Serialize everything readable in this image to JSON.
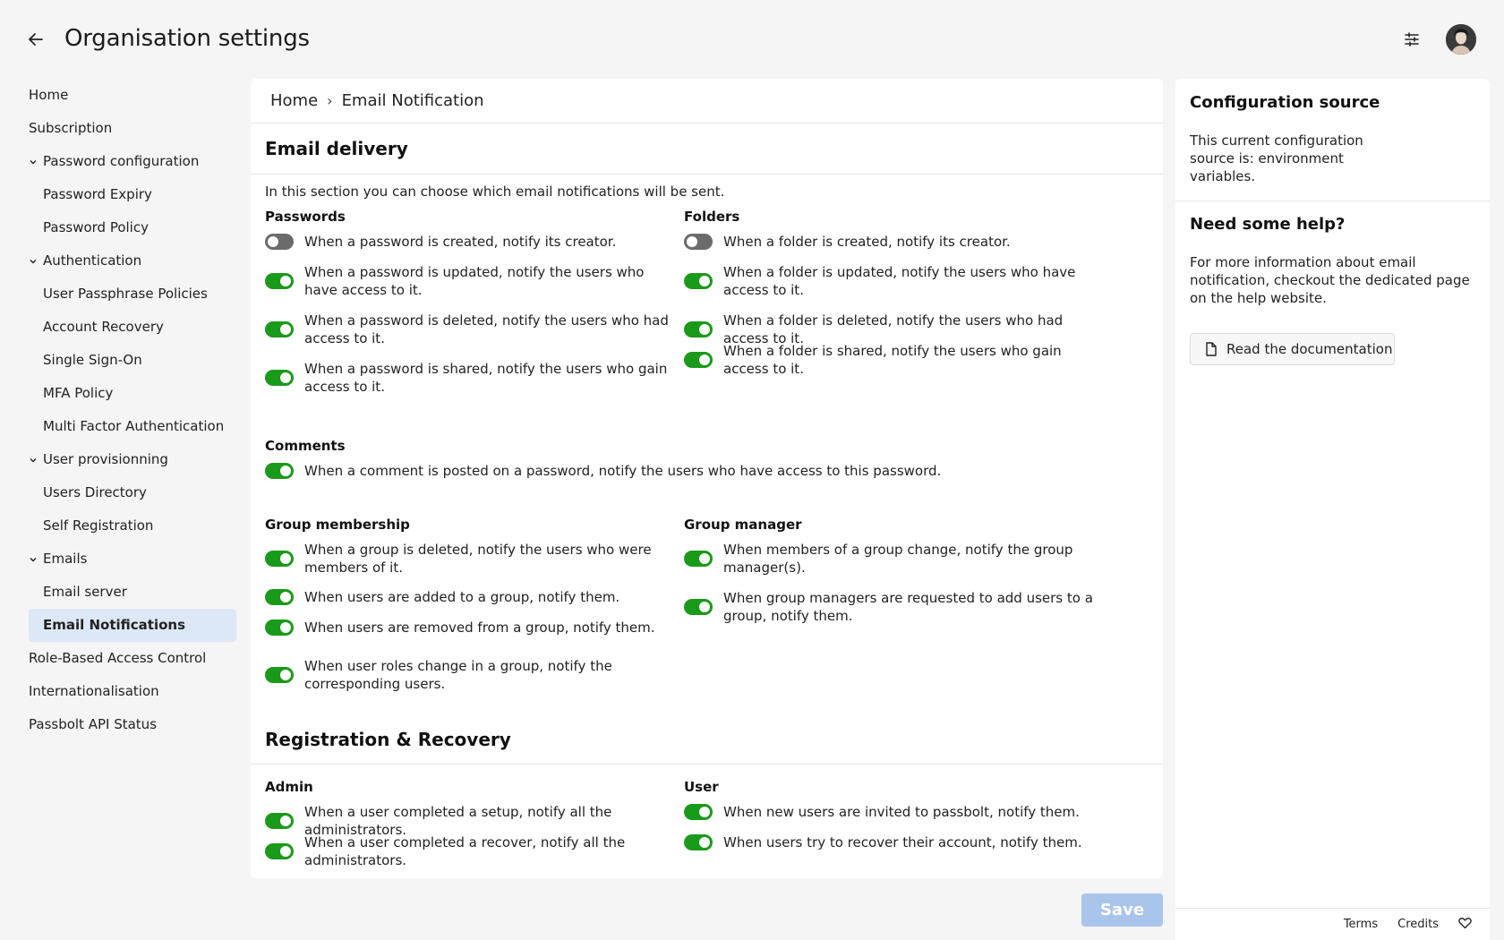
{
  "header": {
    "title": "Organisation settings",
    "back_icon": "arrow-left-icon",
    "filter_icon": "sliders-icon"
  },
  "sidebar": {
    "items": [
      {
        "label": "Home",
        "level": 0
      },
      {
        "label": "Subscription",
        "level": 0
      },
      {
        "label": "Password configuration",
        "level": 1,
        "expandable": true
      },
      {
        "label": "Password Expiry",
        "level": 2
      },
      {
        "label": "Password Policy",
        "level": 2
      },
      {
        "label": "Authentication",
        "level": 1,
        "expandable": true
      },
      {
        "label": "User Passphrase Policies",
        "level": 2
      },
      {
        "label": "Account Recovery",
        "level": 2
      },
      {
        "label": "Single Sign-On",
        "level": 2
      },
      {
        "label": "MFA Policy",
        "level": 2
      },
      {
        "label": "Multi Factor Authentication",
        "level": 2
      },
      {
        "label": "User provisionning",
        "level": 1,
        "expandable": true
      },
      {
        "label": "Users Directory",
        "level": 2
      },
      {
        "label": "Self Registration",
        "level": 2
      },
      {
        "label": "Emails",
        "level": 1,
        "expandable": true
      },
      {
        "label": "Email server",
        "level": 2
      },
      {
        "label": "Email Notifications",
        "level": 2,
        "active": true
      },
      {
        "label": "Role-Based Access Control",
        "level": 0
      },
      {
        "label": "Internationalisation",
        "level": 0
      },
      {
        "label": "Passbolt API Status",
        "level": 0
      }
    ]
  },
  "breadcrumb": {
    "home": "Home",
    "separator": "›",
    "current": "Email Notification"
  },
  "email_delivery": {
    "title": "Email delivery",
    "intro": "In this section you can choose which email notifications will be sent.",
    "passwords": {
      "heading": "Passwords",
      "options": [
        {
          "label": "When a password is created, notify its creator.",
          "on": false
        },
        {
          "label": "When a password is updated, notify the users who have access to it.",
          "on": true
        },
        {
          "label": "When a password is deleted, notify the users who had access to it.",
          "on": true
        },
        {
          "label": "When a password is shared, notify the users who gain access to it.",
          "on": true
        }
      ]
    },
    "folders": {
      "heading": "Folders",
      "options": [
        {
          "label": "When a folder is created, notify its creator.",
          "on": false
        },
        {
          "label": "When a folder is updated, notify the users who have access to it.",
          "on": true
        },
        {
          "label": "When a folder is deleted, notify the users who had access to it.",
          "on": true
        },
        {
          "label": "When a folder is shared, notify the users who gain access to it.",
          "on": true
        }
      ]
    },
    "comments": {
      "heading": "Comments",
      "options": [
        {
          "label": "When a comment is posted on a password, notify the users who have access to this password.",
          "on": true
        }
      ]
    },
    "group_membership": {
      "heading": "Group membership",
      "options": [
        {
          "label": "When a group is deleted, notify the users who were members of it.",
          "on": true
        },
        {
          "label": "When users are added to a group, notify them.",
          "on": true
        },
        {
          "label": "When users are removed from a group, notify them.",
          "on": true
        },
        {
          "label": "When user roles change in a group, notify the corresponding users.",
          "on": true
        }
      ]
    },
    "group_manager": {
      "heading": "Group manager",
      "options": [
        {
          "label": "When members of a group change, notify the group manager(s).",
          "on": true
        },
        {
          "label": "When group managers are requested to add users to a group, notify them.",
          "on": true
        }
      ]
    }
  },
  "registration": {
    "title": "Registration & Recovery",
    "admin": {
      "heading": "Admin",
      "options": [
        {
          "label": "When a user completed a setup, notify all the administrators.",
          "on": true
        },
        {
          "label": "When a user completed a recover, notify all the administrators.",
          "on": true
        }
      ]
    },
    "user": {
      "heading": "User",
      "options": [
        {
          "label": "When new users are invited to passbolt, notify them.",
          "on": true
        },
        {
          "label": "When users try to recover their account, notify them.",
          "on": true
        }
      ]
    }
  },
  "right_panel": {
    "config_title": "Configuration source",
    "config_text": "This current configuration source is: environment variables.",
    "help_title": "Need some help?",
    "help_text": "For more information about email notification, checkout the dedicated page on the help website.",
    "doc_button": "Read the documentation",
    "footer": {
      "terms": "Terms",
      "credits": "Credits"
    }
  },
  "save_label": "Save",
  "colors": {
    "toggle_on": "#1a9a1a",
    "toggle_off": "#6b6b6b",
    "active_bg": "#dde8f7",
    "save_bg": "#a9c5ec"
  }
}
